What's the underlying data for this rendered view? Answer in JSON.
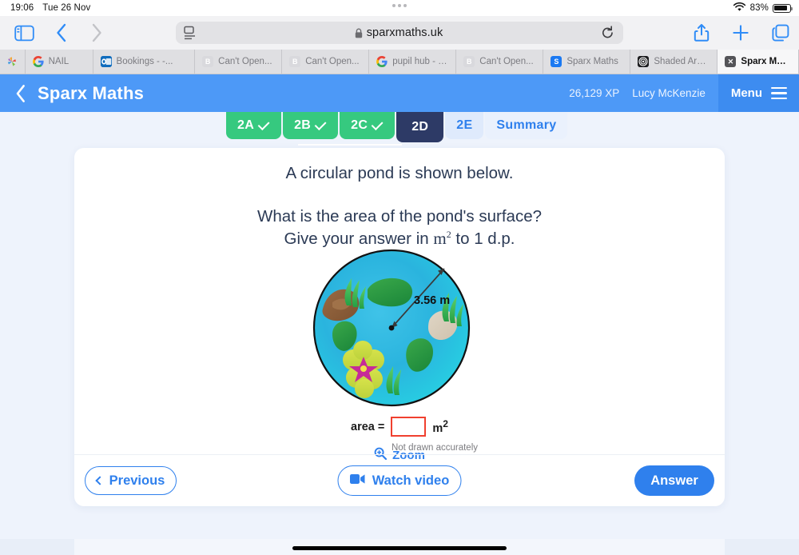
{
  "statusbar": {
    "time": "19:06",
    "date": "Tue 26 Nov",
    "battery_pct": "83%",
    "wifi_icon": "wifi-icon",
    "battery_icon": "battery-icon"
  },
  "browser": {
    "sidebar_icon": "sidebar-toggle-icon",
    "back_icon": "back-chevron-icon",
    "forward_icon": "forward-chevron-icon",
    "aa_icon": "page-settings-icon",
    "lock_icon": "lock-icon",
    "url": "sparxmaths.uk",
    "reload_icon": "reload-icon",
    "share_icon": "share-icon",
    "newtab_icon": "plus-icon",
    "tabs_icon": "tab-overview-icon",
    "tabs": [
      {
        "label": "",
        "favicon": "colorful-pinwheel-icon",
        "active": false
      },
      {
        "label": "NAIL",
        "favicon": "google-icon",
        "active": false
      },
      {
        "label": "Bookings - -...",
        "favicon": "outlook-icon",
        "active": false
      },
      {
        "label": "Can't Open...",
        "favicon": "box-icon",
        "active": false
      },
      {
        "label": "Can't Open...",
        "favicon": "box-icon",
        "active": false
      },
      {
        "label": "pupil hub - G...",
        "favicon": "google-icon",
        "active": false
      },
      {
        "label": "Can't Open...",
        "favicon": "box-icon",
        "active": false
      },
      {
        "label": "Sparx Maths",
        "favicon": "sparx-icon",
        "active": false
      },
      {
        "label": "Shaded Area...",
        "favicon": "spiral-icon",
        "active": false
      },
      {
        "label": "Sparx Maths",
        "favicon": "x-icon",
        "active": true
      }
    ]
  },
  "appheader": {
    "back_icon": "back-chevron-icon",
    "title": "Sparx Maths",
    "xp": "26,129 XP",
    "user": "Lucy McKenzie",
    "menu_label": "Menu",
    "menu_icon": "hamburger-icon"
  },
  "question_tabs": [
    {
      "label": "2A",
      "state": "done"
    },
    {
      "label": "2B",
      "state": "done"
    },
    {
      "label": "2C",
      "state": "done"
    },
    {
      "label": "2D",
      "state": "current"
    },
    {
      "label": "2E",
      "state": "upcoming"
    },
    {
      "label": "Summary",
      "state": "summary"
    }
  ],
  "question": {
    "line1": "A circular pond is shown below.",
    "line2": "What is the area of the pond's surface?",
    "line3_pre": "Give your answer in ",
    "line3_unit": "m",
    "line3_exp": "2",
    "line3_post": " to 1 d.p."
  },
  "diagram": {
    "radius_label": "3.56 m",
    "pond_shape": "circle",
    "pond_fill": "#2eb8e0",
    "note": "Not drawn accurately",
    "features": [
      "lily-pad",
      "rock",
      "seaweed",
      "water-flower"
    ]
  },
  "answer": {
    "label": "area =",
    "value": "",
    "placeholder": "",
    "unit": "m",
    "unit_exp": "2",
    "border_color": "#f0402f"
  },
  "zoom_control": {
    "label": "Zoom",
    "icon": "magnifier-plus-icon"
  },
  "footer": {
    "previous_label": "Previous",
    "previous_icon": "chevron-left-icon",
    "video_label": "Watch video",
    "video_icon": "video-camera-icon",
    "answer_label": "Answer"
  },
  "colors": {
    "header_blue": "#4d99f7",
    "menu_blue": "#3d8cf0",
    "accent_blue": "#2f80ed",
    "done_green": "#36c97f",
    "current_navy": "#2d3a66",
    "page_bg": "#eef3fc",
    "input_red": "#f0402f"
  }
}
